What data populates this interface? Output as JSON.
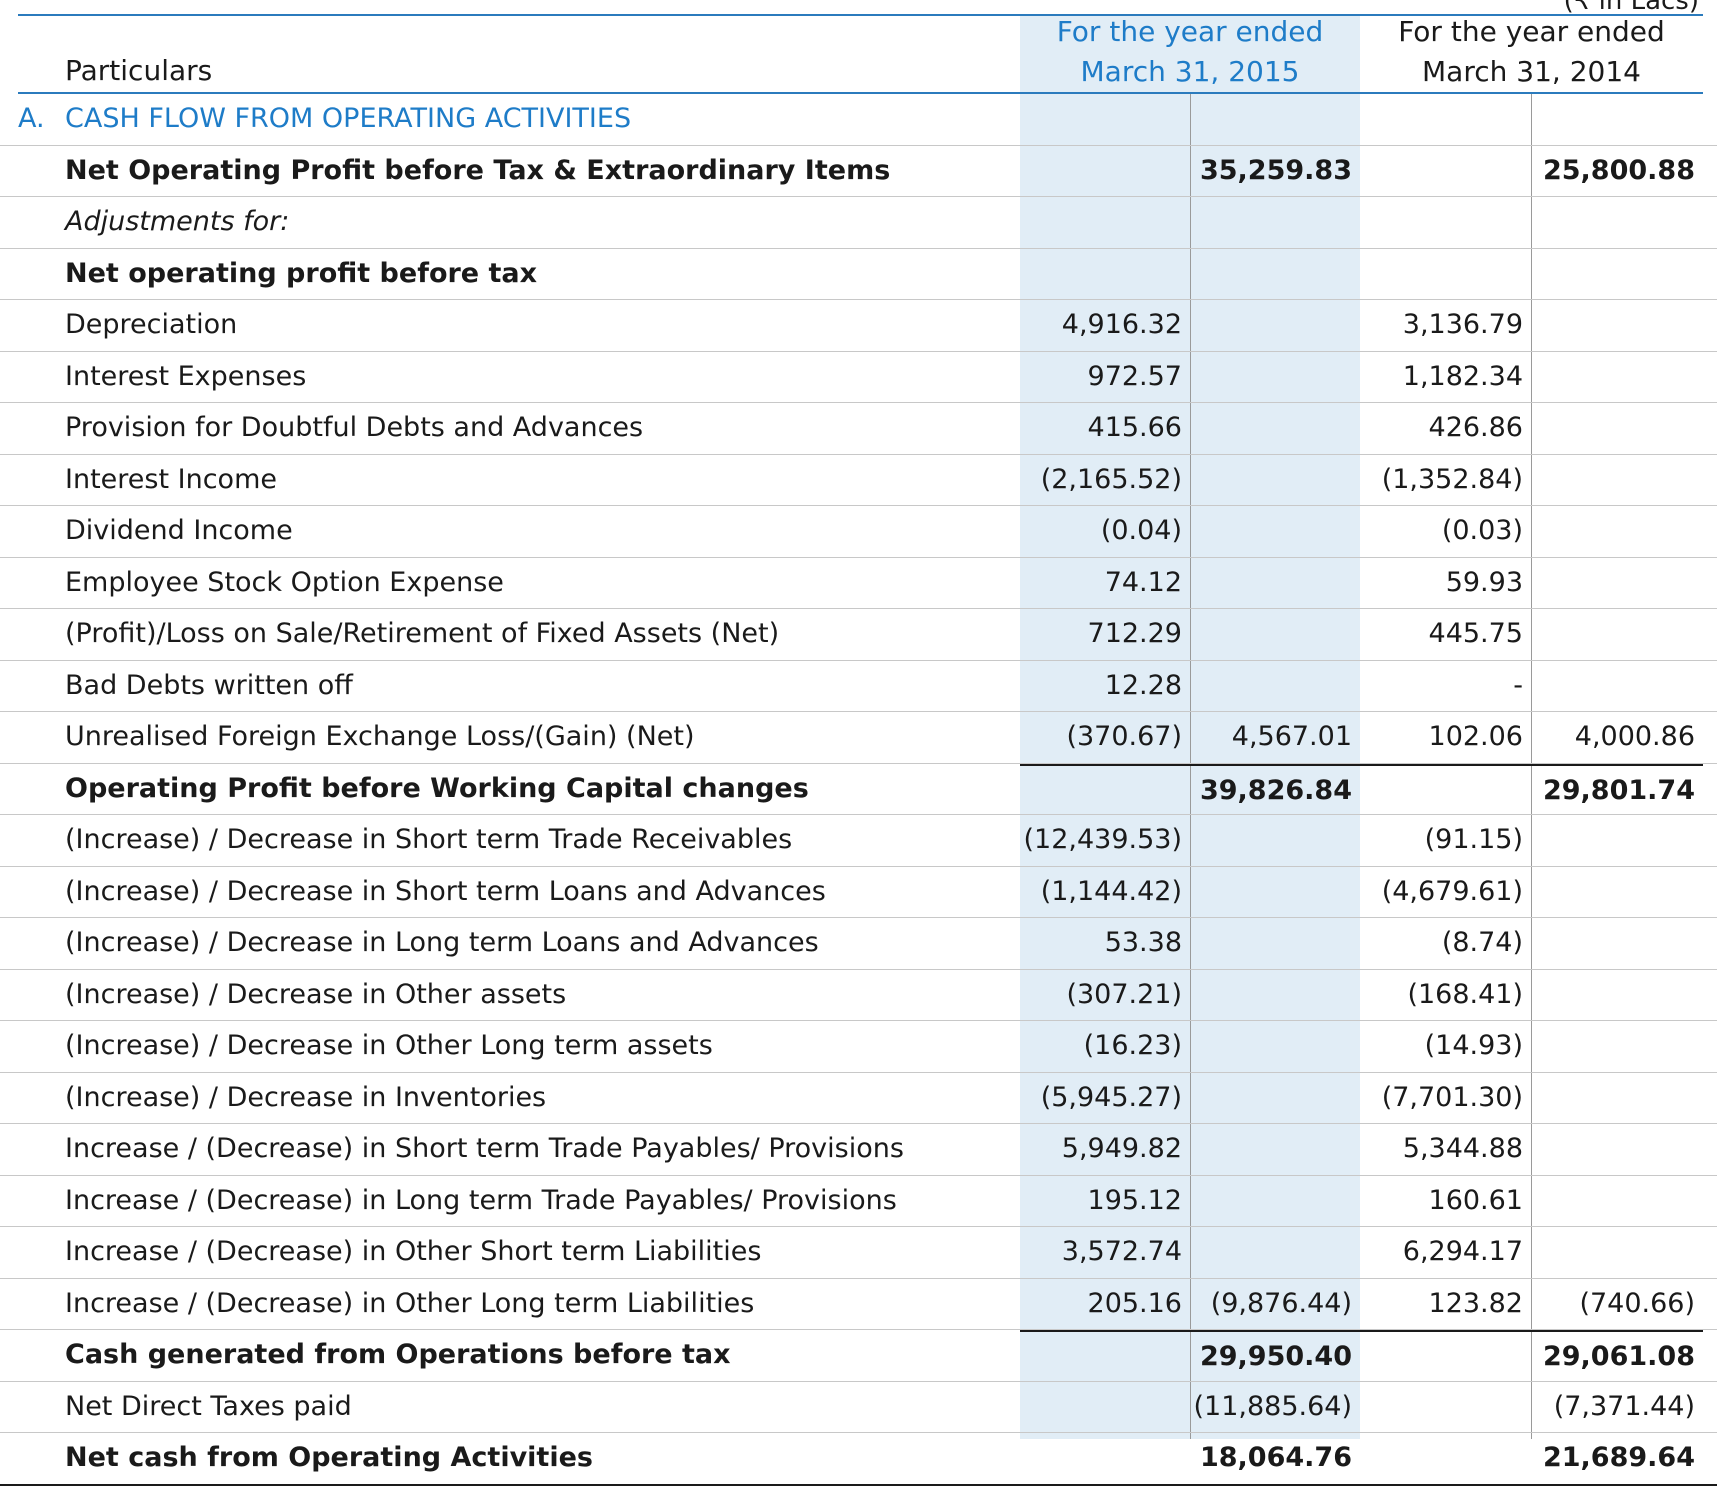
{
  "header": {
    "unit_note": "(₹ in Lacs)",
    "particulars_label": "Particulars",
    "col_2015_line1": "For the year ended",
    "col_2015_line2": "March 31, 2015",
    "col_2014_line1": "For the year ended",
    "col_2014_line2": "March 31, 2014"
  },
  "rows": [
    {
      "label": "CASH FLOW FROM OPERATING ACTIVITIES",
      "letter": "A.",
      "style": "section",
      "c1": "",
      "c2": "",
      "c3": "",
      "c4": ""
    },
    {
      "label": "Net Operating Profit before Tax & Extraordinary Items",
      "style": "bold",
      "c1": "",
      "c2": "35,259.83",
      "c3": "",
      "c4": "25,800.88"
    },
    {
      "label": "Adjustments for:",
      "style": "italic",
      "c1": "",
      "c2": "",
      "c3": "",
      "c4": ""
    },
    {
      "label": "Net operating profit before tax",
      "style": "bold",
      "c1": "",
      "c2": "",
      "c3": "",
      "c4": ""
    },
    {
      "label": "Depreciation",
      "style": "",
      "c1": "4,916.32",
      "c2": "",
      "c3": "3,136.79",
      "c4": ""
    },
    {
      "label": "Interest Expenses",
      "style": "",
      "c1": "972.57",
      "c2": "",
      "c3": "1,182.34",
      "c4": ""
    },
    {
      "label": "Provision for Doubtful Debts and Advances",
      "style": "",
      "c1": "415.66",
      "c2": "",
      "c3": "426.86",
      "c4": ""
    },
    {
      "label": "Interest Income",
      "style": "",
      "c1": "(2,165.52)",
      "c2": "",
      "c3": "(1,352.84)",
      "c4": ""
    },
    {
      "label": "Dividend Income",
      "style": "",
      "c1": "(0.04)",
      "c2": "",
      "c3": "(0.03)",
      "c4": ""
    },
    {
      "label": "Employee Stock Option Expense",
      "style": "",
      "c1": "74.12",
      "c2": "",
      "c3": "59.93",
      "c4": ""
    },
    {
      "label": "(Profit)/Loss on Sale/Retirement of Fixed Assets (Net)",
      "style": "",
      "c1": "712.29",
      "c2": "",
      "c3": "445.75",
      "c4": ""
    },
    {
      "label": "Bad Debts written off",
      "style": "",
      "c1": "12.28",
      "c2": "",
      "c3": "-",
      "c4": ""
    },
    {
      "label": "Unrealised Foreign Exchange Loss/(Gain) (Net)",
      "style": "",
      "c1": "(370.67)",
      "c2": "4,567.01",
      "c3": "102.06",
      "c4": "4,000.86"
    },
    {
      "label": "Operating Profit before Working Capital changes",
      "style": "bold",
      "total": true,
      "c1": "",
      "c2": "39,826.84",
      "c3": "",
      "c4": "29,801.74"
    },
    {
      "label": "(Increase) / Decrease in Short term Trade Receivables",
      "style": "",
      "c1": "(12,439.53)",
      "c2": "",
      "c3": "(91.15)",
      "c4": ""
    },
    {
      "label": "(Increase) / Decrease in Short term Loans and Advances",
      "style": "",
      "c1": "(1,144.42)",
      "c2": "",
      "c3": "(4,679.61)",
      "c4": ""
    },
    {
      "label": "(Increase) / Decrease in Long term Loans and Advances",
      "style": "",
      "c1": "53.38",
      "c2": "",
      "c3": "(8.74)",
      "c4": ""
    },
    {
      "label": "(Increase) / Decrease in Other assets",
      "style": "",
      "c1": "(307.21)",
      "c2": "",
      "c3": "(168.41)",
      "c4": ""
    },
    {
      "label": "(Increase) / Decrease in Other Long term assets",
      "style": "",
      "c1": "(16.23)",
      "c2": "",
      "c3": "(14.93)",
      "c4": ""
    },
    {
      "label": "(Increase) / Decrease in Inventories",
      "style": "",
      "c1": "(5,945.27)",
      "c2": "",
      "c3": "(7,701.30)",
      "c4": ""
    },
    {
      "label": "Increase / (Decrease) in Short term Trade Payables/ Provisions",
      "style": "",
      "c1": "5,949.82",
      "c2": "",
      "c3": "5,344.88",
      "c4": ""
    },
    {
      "label": "Increase / (Decrease) in Long term Trade Payables/ Provisions",
      "style": "",
      "c1": "195.12",
      "c2": "",
      "c3": "160.61",
      "c4": ""
    },
    {
      "label": "Increase / (Decrease) in Other Short term Liabilities",
      "style": "",
      "c1": "3,572.74",
      "c2": "",
      "c3": "6,294.17",
      "c4": ""
    },
    {
      "label": "Increase / (Decrease) in Other Long term Liabilities",
      "style": "",
      "c1": "205.16",
      "c2": "(9,876.44)",
      "c3": "123.82",
      "c4": "(740.66)"
    },
    {
      "label": "Cash generated from Operations before tax",
      "style": "bold",
      "total": true,
      "c1": "",
      "c2": "29,950.40",
      "c3": "",
      "c4": "29,061.08"
    },
    {
      "label": "Net Direct Taxes paid",
      "style": "",
      "c1": "",
      "c2": "(11,885.64)",
      "c3": "",
      "c4": "(7,371.44)"
    },
    {
      "label": "Net cash from Operating Activities",
      "style": "bold",
      "nettotal": true,
      "c1": "",
      "c2": "18,064.76",
      "c3": "",
      "c4": "21,689.64"
    }
  ]
}
